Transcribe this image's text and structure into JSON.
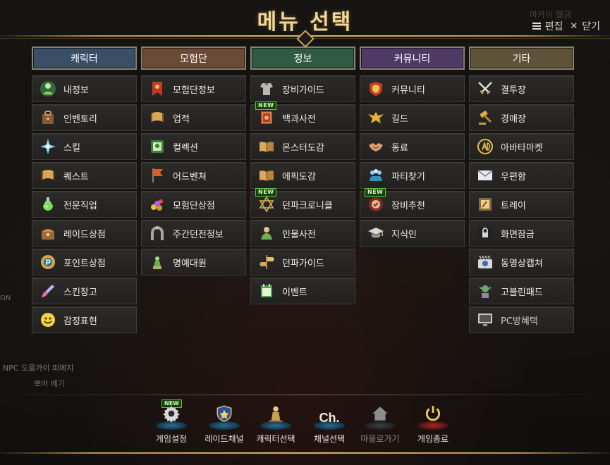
{
  "header": {
    "title": "메뉴 선택",
    "edit_label": "편집",
    "close_label": "닫기",
    "ghost_text": "마카이 헬금"
  },
  "columns": [
    {
      "header": "캐릭터",
      "color": "#3a4e66",
      "items": [
        {
          "label": "내정보",
          "icon": "character-icon"
        },
        {
          "label": "인벤토리",
          "icon": "bag-icon"
        },
        {
          "label": "스킬",
          "icon": "sparkle-icon"
        },
        {
          "label": "퀘스트",
          "icon": "scroll-icon"
        },
        {
          "label": "전문직업",
          "icon": "potion-icon"
        },
        {
          "label": "레이드상점",
          "icon": "chest-icon"
        },
        {
          "label": "포인트상점",
          "icon": "point-shop-icon"
        },
        {
          "label": "스킨창고",
          "icon": "brush-icon"
        },
        {
          "label": "감정표현",
          "icon": "smiley-icon"
        }
      ]
    },
    {
      "header": "모험단",
      "color": "#6b4a36",
      "items": [
        {
          "label": "모험단정보",
          "icon": "banner-icon"
        },
        {
          "label": "업적",
          "icon": "scroll-icon"
        },
        {
          "label": "컬렉션",
          "icon": "card-book-icon"
        },
        {
          "label": "어드벤쳐",
          "icon": "flag-icon"
        },
        {
          "label": "모험단상점",
          "icon": "treasure-icon"
        },
        {
          "label": "주간던전정보",
          "icon": "gate-icon"
        },
        {
          "label": "명예대원",
          "icon": "statue-icon"
        }
      ]
    },
    {
      "header": "정보",
      "color": "#2f5a43",
      "items": [
        {
          "label": "장비가이드",
          "icon": "armor-icon",
          "new": false
        },
        {
          "label": "백과사전",
          "icon": "book-icon",
          "new": true
        },
        {
          "label": "몬스터도감",
          "icon": "open-book-icon",
          "new": false
        },
        {
          "label": "에픽도감",
          "icon": "open-book-icon",
          "new": false
        },
        {
          "label": "던파크로니클",
          "icon": "hexagram-icon",
          "new": true
        },
        {
          "label": "인물사전",
          "icon": "person-icon",
          "new": false
        },
        {
          "label": "던파가이드",
          "icon": "signpost-icon",
          "new": false
        },
        {
          "label": "이벤트",
          "icon": "calendar-icon",
          "new": false
        }
      ]
    },
    {
      "header": "커뮤니티",
      "color": "#4f3a66",
      "items": [
        {
          "label": "커뮤니티",
          "icon": "shield-icon",
          "new": false
        },
        {
          "label": "길드",
          "icon": "eagle-icon",
          "new": false
        },
        {
          "label": "동료",
          "icon": "handshake-icon",
          "new": false
        },
        {
          "label": "파티찾기",
          "icon": "party-icon",
          "new": false
        },
        {
          "label": "장비추천",
          "icon": "recommend-icon",
          "new": true
        },
        {
          "label": "지식인",
          "icon": "graduation-cap-icon",
          "new": false
        }
      ]
    },
    {
      "header": "기타",
      "color": "#5e5238",
      "items": [
        {
          "label": "결투장",
          "icon": "crossed-swords-icon",
          "dim": false
        },
        {
          "label": "경매장",
          "icon": "gavel-icon",
          "dim": false
        },
        {
          "label": "아바타마켓",
          "icon": "avatar-market-icon",
          "dim": false
        },
        {
          "label": "우편함",
          "icon": "mail-icon",
          "dim": false
        },
        {
          "label": "트레이",
          "icon": "tray-icon",
          "dim": false
        },
        {
          "label": "화면잠금",
          "icon": "lock-icon",
          "dim": false
        },
        {
          "label": "동영상캡쳐",
          "icon": "camera-icon",
          "dim": false
        },
        {
          "label": "고블린패드",
          "icon": "goblin-icon",
          "dim": false
        },
        {
          "label": "PC방혜택",
          "icon": "monitor-icon",
          "dim": true
        }
      ]
    }
  ],
  "bottom_bar": [
    {
      "label": "게임설정",
      "icon": "gear-icon",
      "new": true,
      "enabled": true
    },
    {
      "label": "레이드채널",
      "icon": "raid-shield-icon",
      "new": false,
      "enabled": true
    },
    {
      "label": "캐릭터선택",
      "icon": "character-select-icon",
      "new": false,
      "enabled": true
    },
    {
      "label": "채널선택",
      "icon": "channel-icon",
      "glyph": "Ch.",
      "new": false,
      "enabled": true
    },
    {
      "label": "마을로가기",
      "icon": "home-icon",
      "new": false,
      "enabled": false
    },
    {
      "label": "게임종료",
      "icon": "power-icon",
      "new": false,
      "enabled": true
    }
  ],
  "new_badge": "NEW",
  "side_text": {
    "npc_line1": "NPC 도움가이 피에지",
    "npc_line2": "뽀바 베기",
    "edge": "ON"
  }
}
